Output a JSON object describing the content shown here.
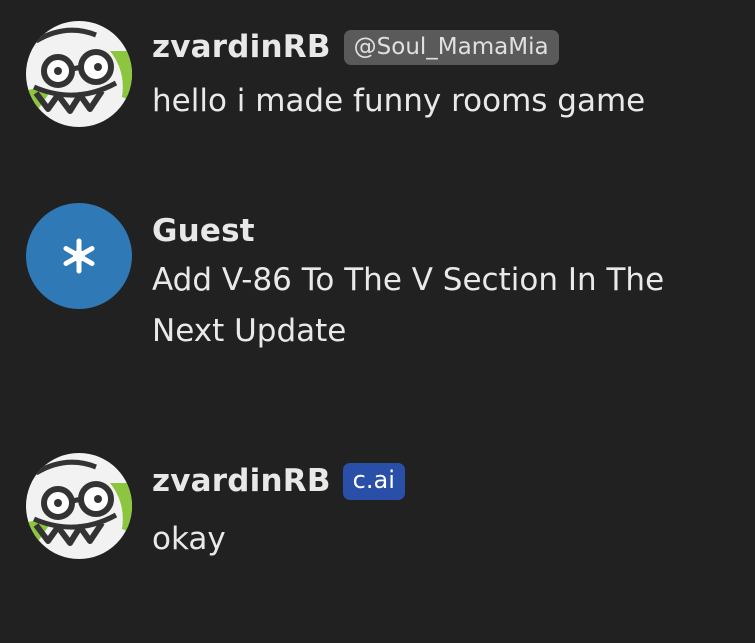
{
  "messages": [
    {
      "author": "zvardinRB",
      "badge": "@Soul_MamaMia",
      "text": "hello i made funny rooms game",
      "avatar": "goggle-monster-avatar"
    },
    {
      "author": "Guest",
      "text": "Add V-86 To The V Section In The Next Update",
      "avatar": "asterisk-icon"
    },
    {
      "author": "zvardinRB",
      "badge": "c.ai",
      "text": "okay",
      "avatar": "goggle-monster-avatar"
    }
  ],
  "colors": {
    "background": "#212121",
    "guest_avatar": "#2f79b6",
    "handle_badge": "#5a5a5a",
    "cai_badge": "#2a4fa8",
    "monster_green": "#8cc63f"
  }
}
